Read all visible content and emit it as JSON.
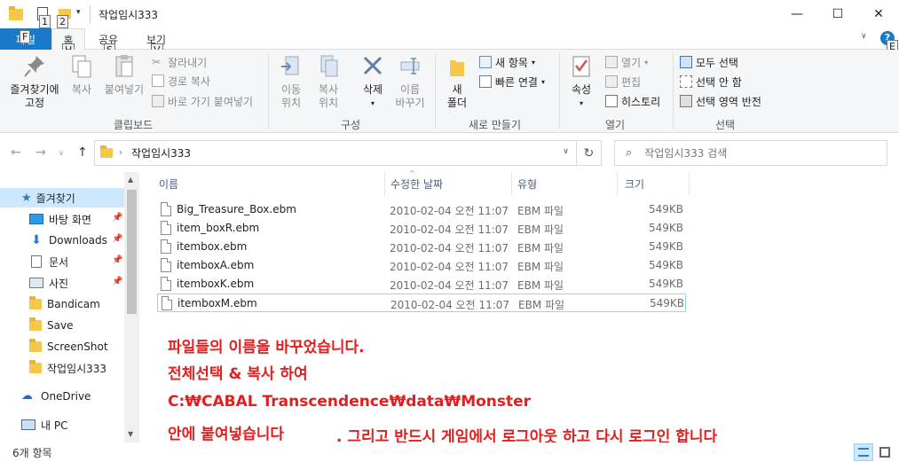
{
  "window": {
    "title": "작업임시333",
    "keytips": [
      "1",
      "2"
    ],
    "controls": {
      "minimize": "—",
      "maximize": "☐",
      "close": "✕"
    }
  },
  "ribbon_tabs": {
    "file": "파일",
    "file_keytip": "F",
    "tabs": [
      {
        "label": "홈",
        "keytip": "H"
      },
      {
        "label": "공유",
        "keytip": "S"
      },
      {
        "label": "보기",
        "keytip": "V"
      }
    ],
    "help_keytip": "E"
  },
  "ribbon": {
    "clipboard": {
      "group_label": "클립보드",
      "pin_line1": "즐겨찾기에",
      "pin_line2": "고정",
      "copy": "복사",
      "paste": "붙여넣기",
      "cut": "잘라내기",
      "copy_path": "경로 복사",
      "paste_shortcut": "바로 가기 붙여넣기"
    },
    "organize": {
      "group_label": "구성",
      "move_line1": "이동",
      "move_line2": "위치",
      "copyto_line1": "복사",
      "copyto_line2": "위치",
      "delete": "삭제",
      "rename_line1": "이름",
      "rename_line2": "바꾸기"
    },
    "new": {
      "group_label": "새로 만들기",
      "new_folder_line1": "새",
      "new_folder_line2": "폴더",
      "new_item": "새 항목",
      "easy_access": "빠른 연결"
    },
    "open": {
      "group_label": "열기",
      "properties": "속성",
      "open": "열기",
      "edit": "편집",
      "history": "히스토리"
    },
    "select": {
      "group_label": "선택",
      "select_all": "모두 선택",
      "select_none": "선택 안 함",
      "invert": "선택 영역 반전"
    }
  },
  "address": {
    "path": "작업임시333",
    "search_placeholder": "작업임시333 검색"
  },
  "nav": {
    "quick_access": "즐겨찾기",
    "items": [
      {
        "label": "바탕 화면",
        "icon": "desktop-icon",
        "pinned": true
      },
      {
        "label": "Downloads",
        "icon": "download-icon",
        "pinned": true
      },
      {
        "label": "문서",
        "icon": "document-icon",
        "pinned": true
      },
      {
        "label": "사진",
        "icon": "picture-icon",
        "pinned": true
      },
      {
        "label": "Bandicam",
        "icon": "folder-icon",
        "pinned": false
      },
      {
        "label": "Save",
        "icon": "folder-icon",
        "pinned": false
      },
      {
        "label": "ScreenShot",
        "icon": "folder-icon",
        "pinned": false
      },
      {
        "label": "작업임시333",
        "icon": "folder-icon",
        "pinned": false
      }
    ],
    "onedrive": "OneDrive",
    "this_pc": "내 PC"
  },
  "columns": {
    "name": "이름",
    "modified": "수정한 날짜",
    "type": "유형",
    "size": "크기"
  },
  "files": [
    {
      "name": "Big_Treasure_Box.ebm",
      "modified": "2010-02-04 오전 11:07",
      "type": "EBM 파일",
      "size": "549KB"
    },
    {
      "name": "item_boxR.ebm",
      "modified": "2010-02-04 오전 11:07",
      "type": "EBM 파일",
      "size": "549KB"
    },
    {
      "name": "itembox.ebm",
      "modified": "2010-02-04 오전 11:07",
      "type": "EBM 파일",
      "size": "549KB"
    },
    {
      "name": "itemboxA.ebm",
      "modified": "2010-02-04 오전 11:07",
      "type": "EBM 파일",
      "size": "549KB"
    },
    {
      "name": "itemboxK.ebm",
      "modified": "2010-02-04 오전 11:07",
      "type": "EBM 파일",
      "size": "549KB"
    },
    {
      "name": "itemboxM.ebm",
      "modified": "2010-02-04 오전 11:07",
      "type": "EBM 파일",
      "size": "549KB"
    }
  ],
  "annotation": {
    "line1": "파일들의 이름을 바꾸었습니다.",
    "line2": "전체선택 & 복사 하여",
    "line3": "C:₩CABAL Transcendence₩data₩Monster",
    "line4": "안에 붙여넣습니다",
    "line5": ".  그리고 반드시 게임에서 로그아웃 하고 다시 로그인 합니다"
  },
  "status": {
    "count": "6개 항목"
  }
}
